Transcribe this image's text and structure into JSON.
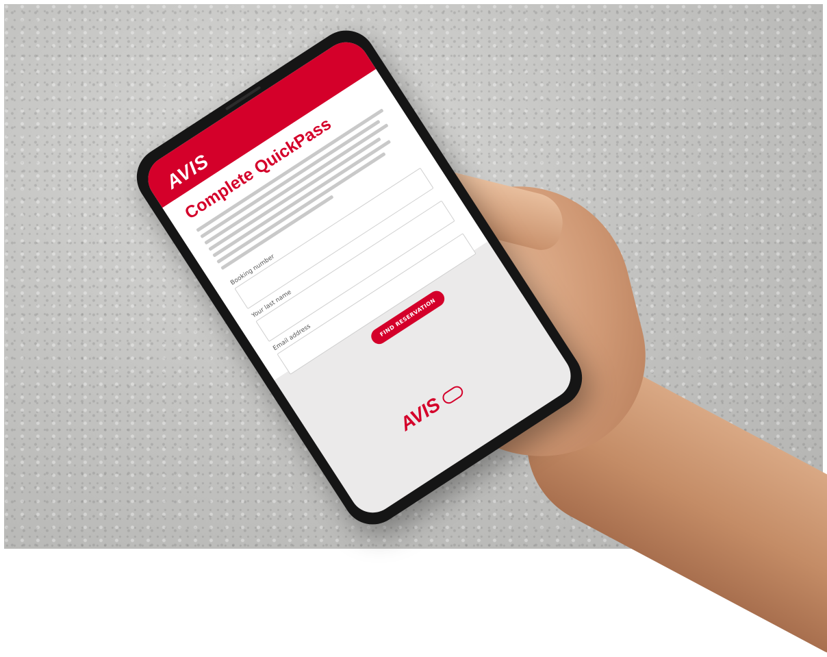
{
  "scene": {
    "description_colors": {
      "brand_red": "#d4002a",
      "screen_bg": "#ebeaea",
      "phone": "#151515"
    }
  },
  "app": {
    "brand": "AVIS",
    "title": "Complete QuickPass",
    "fields": [
      {
        "label": "Booking number"
      },
      {
        "label": "Your last name"
      },
      {
        "label": "Email address"
      }
    ],
    "cta_label": "FIND RESERVATION"
  }
}
